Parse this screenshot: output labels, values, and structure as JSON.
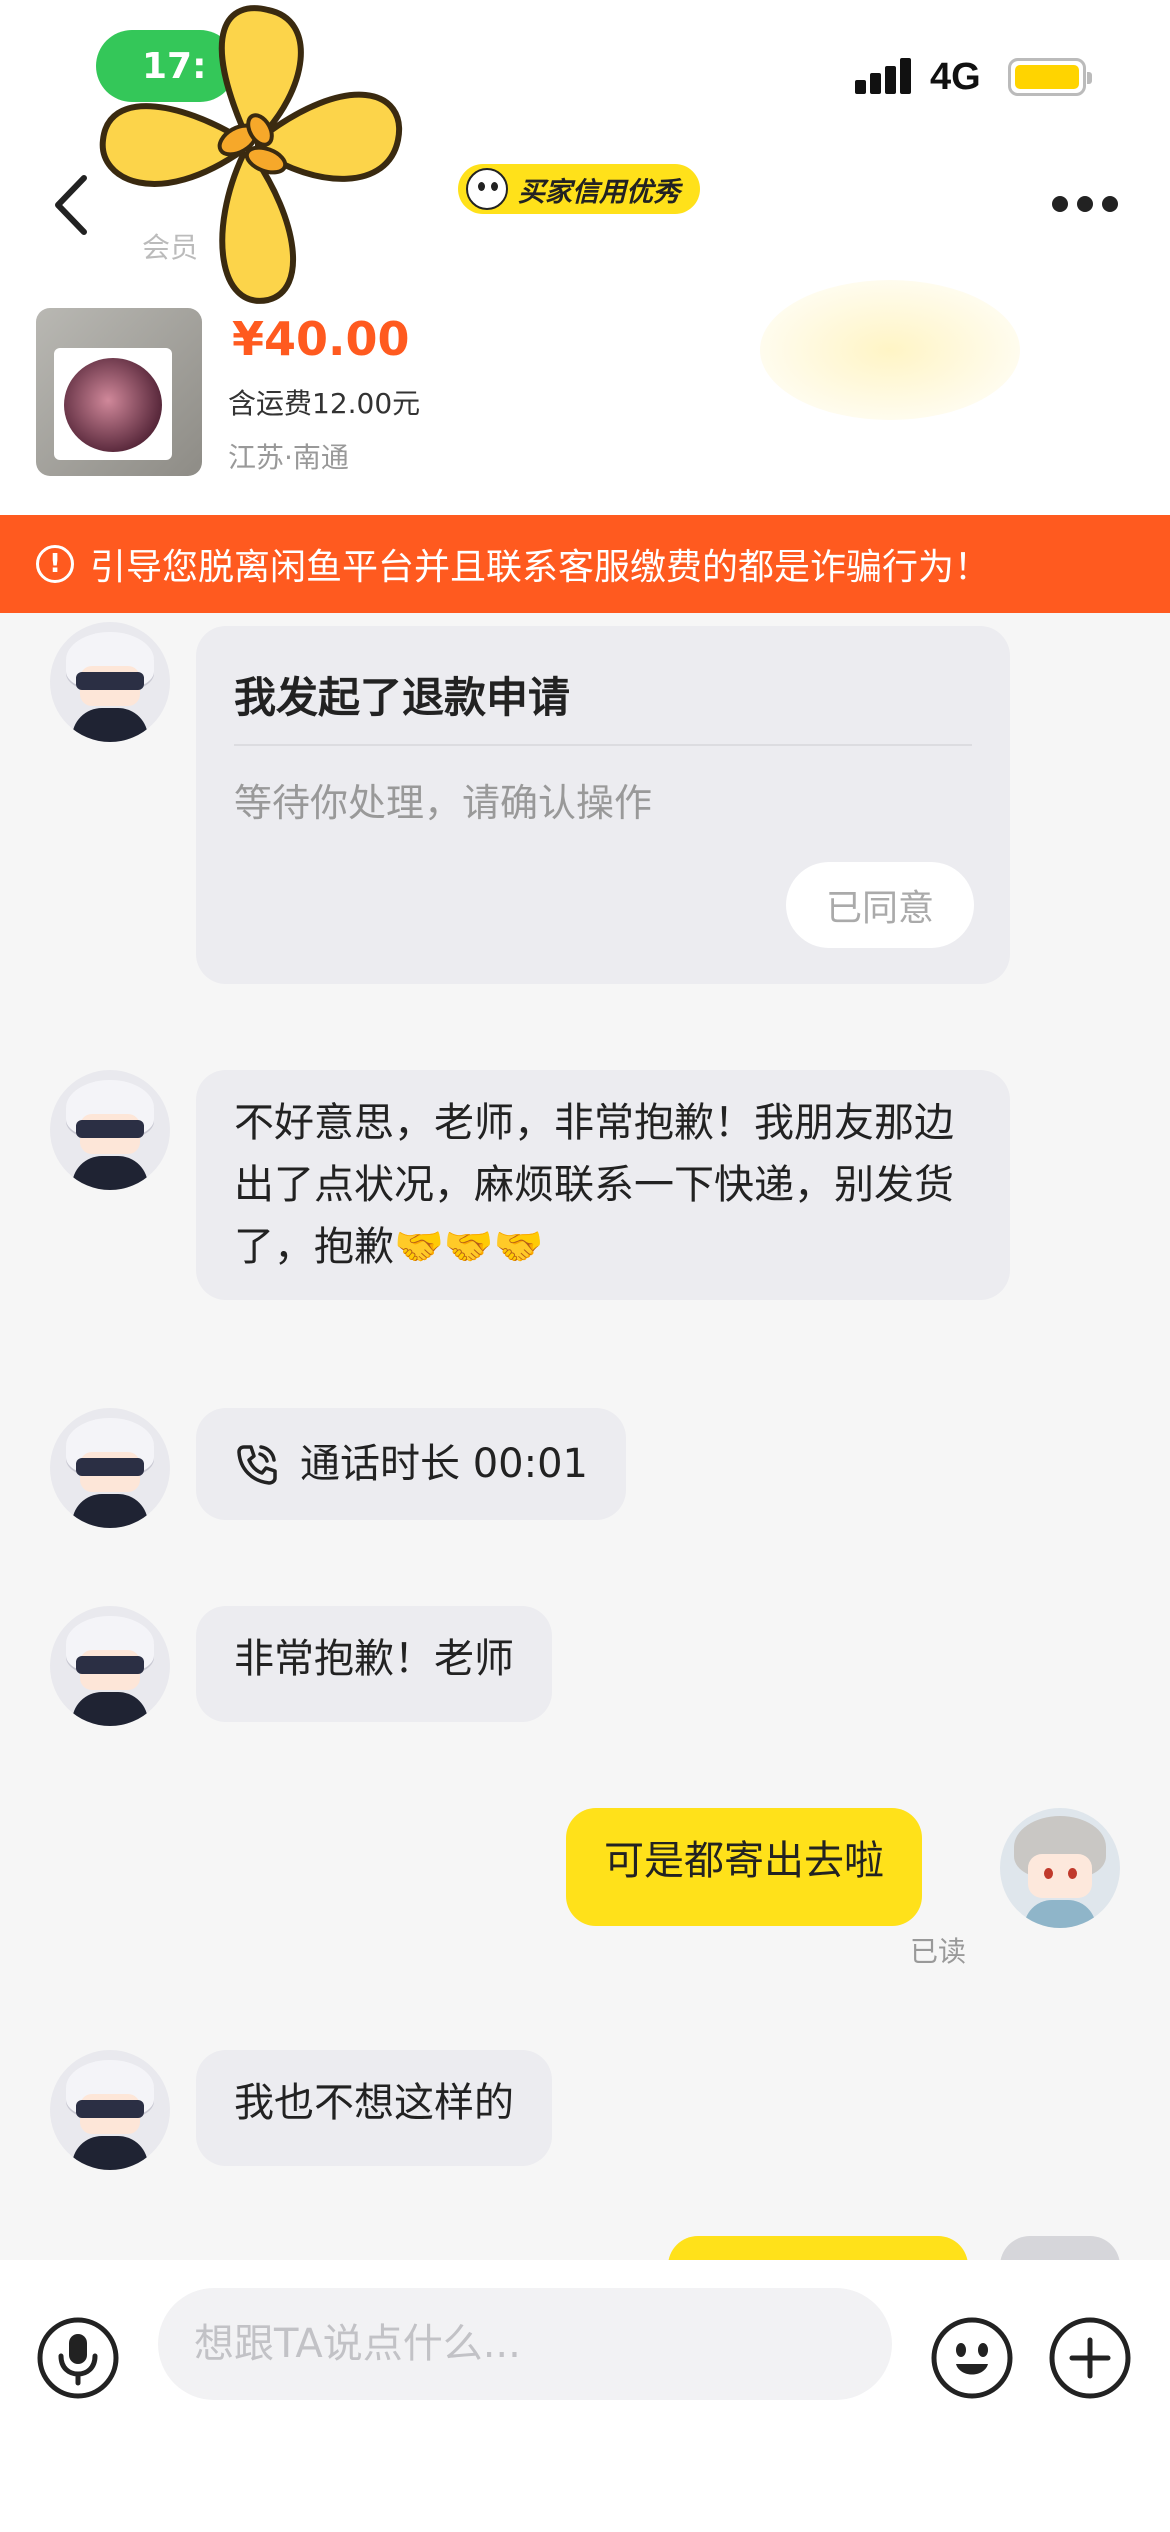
{
  "status_bar": {
    "time": "17:",
    "network": "4G",
    "colors": {
      "time_pill": "#34c759",
      "battery": "#ffd400"
    }
  },
  "header": {
    "member_label": "会员",
    "credit_badge": "买家信用优秀",
    "icons": [
      "back-icon",
      "flower-sticker",
      "more-icon"
    ]
  },
  "product": {
    "price": "¥40.00",
    "shipping": "含运费12.00元",
    "location": "江苏·南通"
  },
  "warning": {
    "text": "引导您脱离闲鱼平台并且联系客服缴费的都是诈骗行为！",
    "color": "#ff5a1f"
  },
  "messages": {
    "refund": {
      "title": "我发起了退款申请",
      "subtitle": "等待你处理，请确认操作",
      "status": "已同意"
    },
    "m1": "不好意思，老师，非常抱歉！我朋友那边出了点状况，麻烦联系一下快递，别发货了，抱歉🤝🤝🤝",
    "call": "通话时长 00:01",
    "m2": "非常抱歉！老师",
    "mine1": "可是都寄出去啦",
    "read_receipt": "已读",
    "m3": "我也不想这样的"
  },
  "input": {
    "placeholder": "想跟TA说点什么...",
    "icons": [
      "mic-icon",
      "emoji-icon",
      "plus-icon"
    ]
  },
  "colors": {
    "accent_yellow": "#ffe11a",
    "other_bubble": "#ececf0"
  }
}
